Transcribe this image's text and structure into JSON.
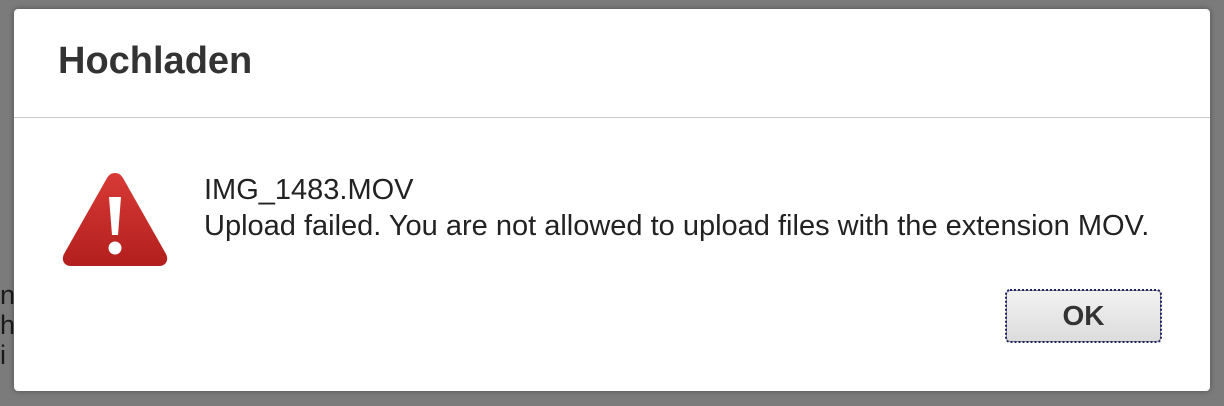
{
  "dialog": {
    "title": "Hochladen",
    "icon": "warning-icon",
    "filename": "IMG_1483.MOV",
    "error_message": "Upload failed. You are not allowed to upload files with the extension MOV.",
    "ok_label": "OK"
  },
  "colors": {
    "warning_red": "#c62a28",
    "title_text": "#333333",
    "overlay": "#7b7b7b"
  }
}
